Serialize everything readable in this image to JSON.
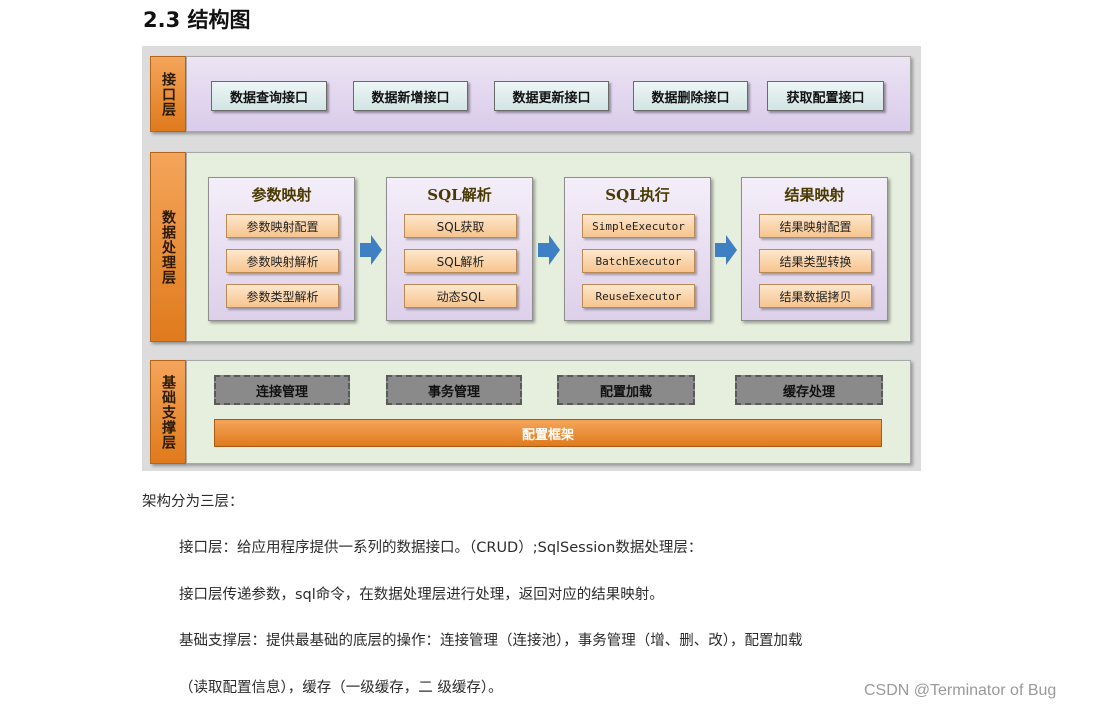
{
  "heading": "2.3 结构图",
  "diagram": {
    "api_layer": {
      "label": "接口层",
      "boxes": [
        "数据查询接口",
        "数据新增接口",
        "数据更新接口",
        "数据删除接口",
        "获取配置接口"
      ]
    },
    "processing_layer": {
      "label": "数据处理层",
      "modules": [
        {
          "title": "参数映射",
          "items": [
            "参数映射配置",
            "参数映射解析",
            "参数类型解析"
          ]
        },
        {
          "title": "SQL解析",
          "items": [
            "SQL获取",
            "SQL解析",
            "动态SQL"
          ]
        },
        {
          "title": "SQL执行",
          "items": [
            "SimpleExecutor",
            "BatchExecutor",
            "ReuseExecutor"
          ]
        },
        {
          "title": "结果映射",
          "items": [
            "结果映射配置",
            "结果类型转换",
            "结果数据拷贝"
          ]
        }
      ]
    },
    "support_layer": {
      "label": "基础支撑层",
      "boxes": [
        "连接管理",
        "事务管理",
        "配置加载",
        "缓存处理"
      ],
      "config_bar": "配置框架"
    }
  },
  "text": {
    "intro": "架构分为三层：",
    "line1": "接口层：给应用程序提供一系列的数据接口。（CRUD）;SqlSession数据处理层：",
    "line2": "接口层传递参数，sql命令，在数据处理层进行处理，返回对应的结果映射。",
    "line3": "基础支撑层：提供最基础的底层的操作：连接管理（连接池），事务管理（增、删、改），配置加载",
    "line4": "（读取配置信息），缓存（一级缓存，二 级缓存）。"
  },
  "watermark": "CSDN @Terminator of Bug",
  "colors": {
    "layer_label": "#e88a2e",
    "module_item": "#f9d3a6",
    "arrow": "#3f7fc4",
    "base_box": "#8a8a8a"
  }
}
